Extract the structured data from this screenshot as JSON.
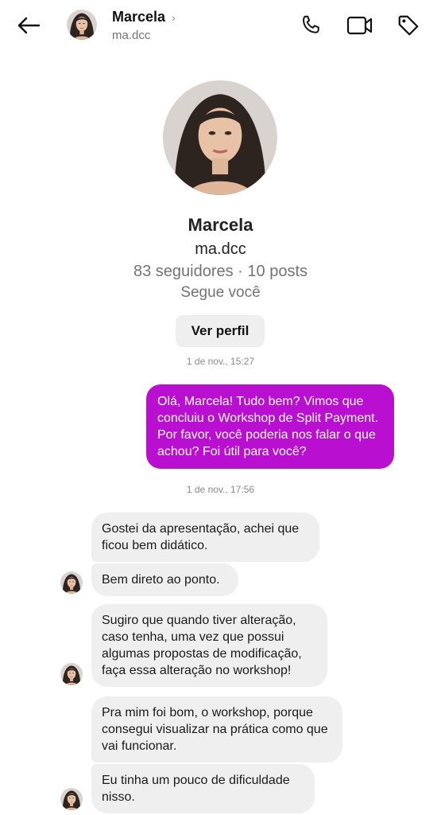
{
  "header": {
    "name": "Marcela",
    "username": "ma.dcc",
    "chevron": "›"
  },
  "profile": {
    "name": "Marcela",
    "username": "ma.dcc",
    "stats": "83 seguidores · 10 posts",
    "follow_status": "Segue você",
    "view_profile_label": "Ver perfil"
  },
  "conversation": {
    "timestamp_1": "1 de nov., 15:27",
    "timestamp_2": "1 de nov., 17:56",
    "outgoing": [
      "Olá, Marcela! Tudo bem? Vimos que concluiu o Workshop de Split Payment. Por favor, você poderia nos falar o que achou? Foi útil para você?"
    ],
    "incoming": [
      "Gostei da apresentação, achei que ficou bem didático.",
      "Bem direto ao ponto.",
      "Sugiro que quando tiver alteração, caso tenha, uma vez que possui algumas propostas de modificação, faça essa alteração no workshop!",
      "Pra mim foi bom, o workshop, porque consegui visualizar na prática como que vai funcionar.",
      "Eu tinha um pouco de dificuldade nisso."
    ]
  },
  "icons": {
    "back": "arrow-left-icon",
    "call": "phone-icon",
    "video": "video-camera-icon",
    "tag": "tag-icon"
  },
  "colors": {
    "outgoing_bubble": "#b80fd1",
    "incoming_bubble": "#efefef",
    "secondary_text": "#737373"
  }
}
